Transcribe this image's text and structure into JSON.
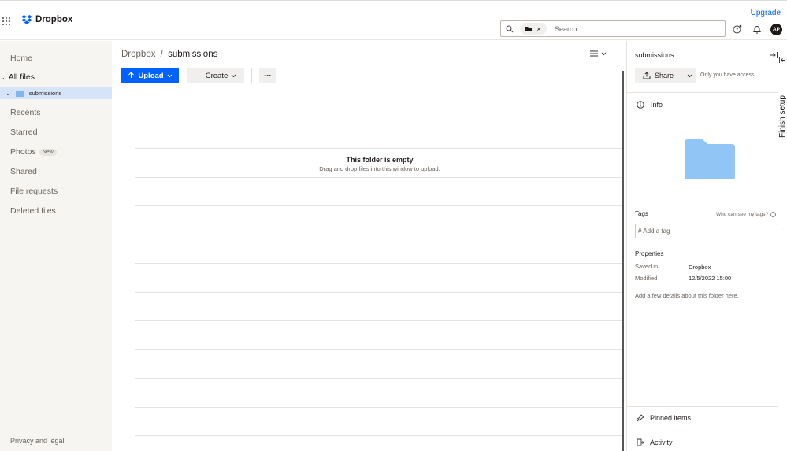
{
  "header": {
    "app_name": "Dropbox",
    "upgrade": "Upgrade",
    "search_placeholder": "Search",
    "chip_close": "×",
    "avatar_initials": "AP"
  },
  "sidebar": {
    "home": "Home",
    "all_files": "All files",
    "tree_item": "submissions",
    "recents": "Recents",
    "starred": "Starred",
    "photos": "Photos",
    "photos_badge": "New",
    "shared": "Shared",
    "file_requests": "File requests",
    "deleted_files": "Deleted files",
    "privacy": "Privacy and legal"
  },
  "main": {
    "breadcrumb_root": "Dropbox",
    "breadcrumb_sep": "/",
    "breadcrumb_current": "submissions",
    "upload_label": "Upload",
    "create_label": "Create",
    "more_label": "···",
    "empty_title": "This folder is empty",
    "empty_sub": "Drag and drop files into this window to upload."
  },
  "panel": {
    "title": "submissions",
    "share_label": "Share",
    "access": "Only you have access",
    "info_label": "Info",
    "tags_label": "Tags",
    "tags_help": "Who can see my tags?",
    "tag_placeholder": "# Add a tag",
    "properties_label": "Properties",
    "saved_in_key": "Saved in",
    "saved_in_val": "Dropbox",
    "modified_key": "Modified",
    "modified_val": "12/5/2022 15:00",
    "add_details": "Add a few details about this folder here.",
    "pinned_items": "Pinned items",
    "activity": "Activity"
  },
  "finish_setup": "Finish setup",
  "colors": {
    "accent": "#0061fe",
    "folder": "#90c5f6",
    "selected_row": "#d6e4f9",
    "sidebar_bg": "#f7f5f2"
  }
}
